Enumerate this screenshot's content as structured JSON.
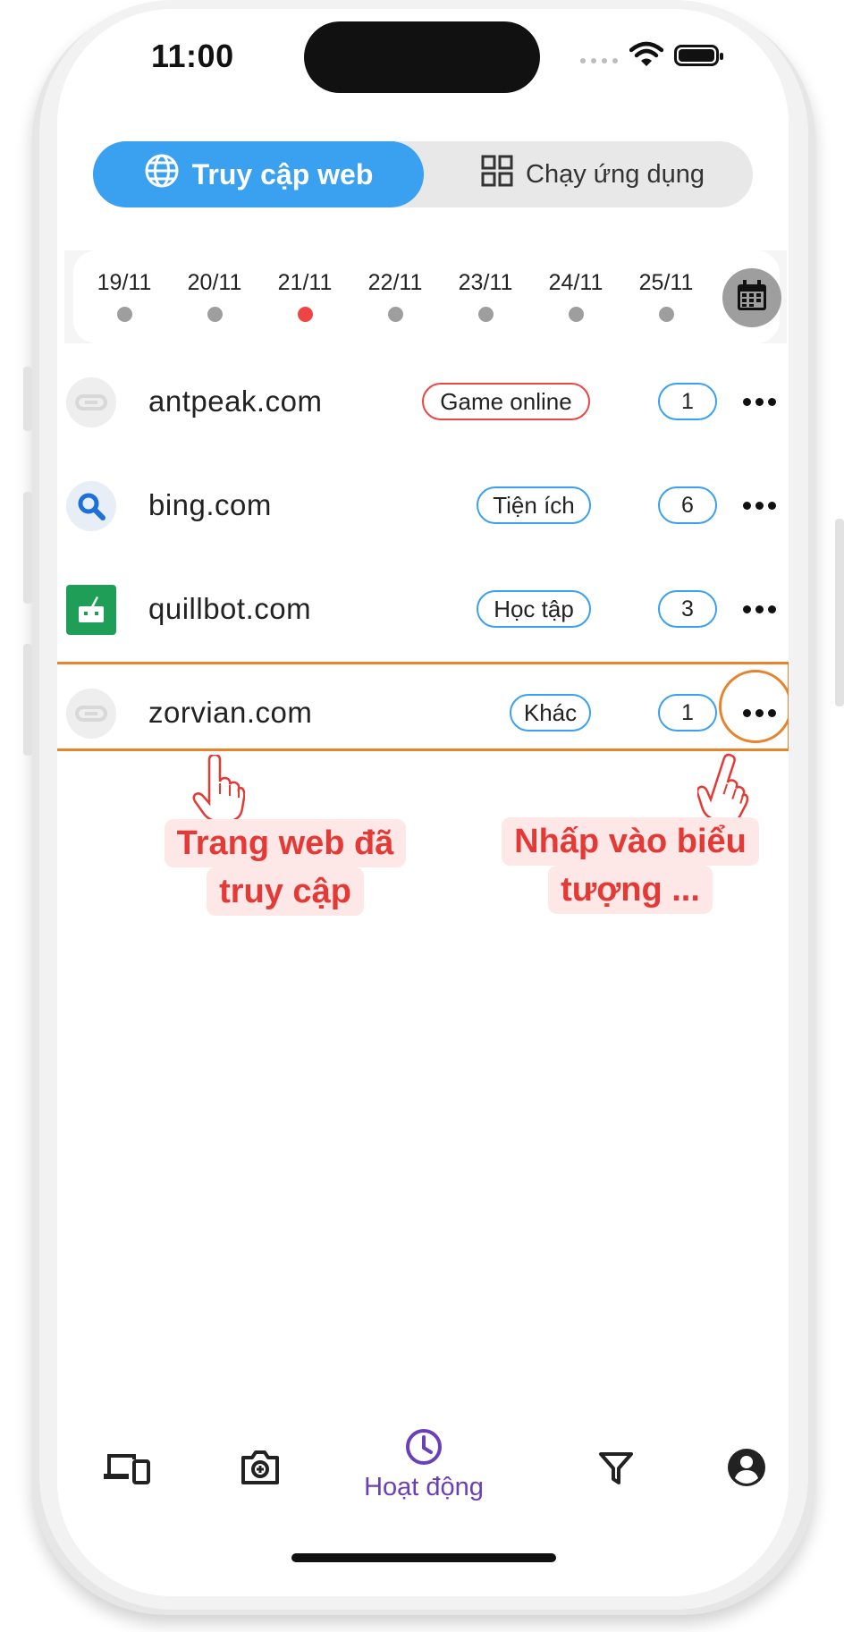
{
  "status_bar": {
    "time": "11:00"
  },
  "tabs": [
    {
      "label": "Truy cập web",
      "icon": "globe-icon",
      "active": true
    },
    {
      "label": "Chạy ứng dụng",
      "icon": "apps-grid-icon",
      "active": false
    }
  ],
  "dates": [
    {
      "label": "19/11",
      "active": false
    },
    {
      "label": "20/11",
      "active": false
    },
    {
      "label": "21/11",
      "active": true
    },
    {
      "label": "22/11",
      "active": false
    },
    {
      "label": "23/11",
      "active": false
    },
    {
      "label": "24/11",
      "active": false
    },
    {
      "label": "25/11",
      "active": false
    }
  ],
  "sites": [
    {
      "domain": "antpeak.com",
      "category": "Game online",
      "count": "1",
      "icon": "link-icon"
    },
    {
      "domain": "bing.com",
      "category": "Tiện ích",
      "count": "6",
      "icon": "search-icon"
    },
    {
      "domain": "quillbot.com",
      "category": "Học tập",
      "count": "3",
      "icon": "quillbot-logo-icon"
    },
    {
      "domain": "zorvian.com",
      "category": "Khác",
      "count": "1",
      "icon": "link-icon"
    }
  ],
  "callouts": {
    "left_line1": "Trang web đã",
    "left_line2": "truy cập",
    "right_line1": "Nhấp vào biểu",
    "right_line2": "tượng ..."
  },
  "bottom_nav": {
    "active_label": "Hoạt động",
    "items": [
      "devices-icon",
      "camera-icon",
      "clock-icon",
      "filter-icon",
      "account-icon"
    ]
  },
  "colors": {
    "accent_blue": "#3aa0f0",
    "highlight_orange": "#e8822c",
    "callout_red": "#e53935",
    "nav_purple": "#6a3fb8",
    "active_dot": "#ef4444"
  }
}
